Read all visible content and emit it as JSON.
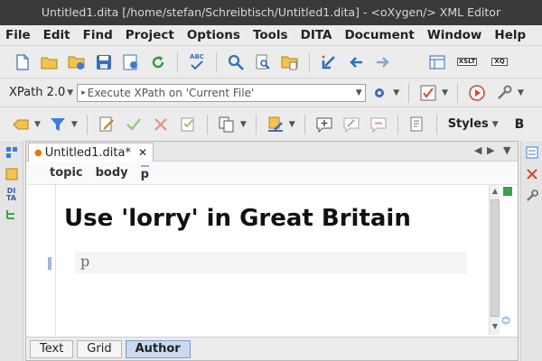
{
  "window": {
    "title": "Untitled1.dita [/home/stefan/Schreibtisch/Untitled1.dita] - <oXygen/> XML Editor"
  },
  "menu": [
    {
      "label": "File"
    },
    {
      "label": "Edit"
    },
    {
      "label": "Find"
    },
    {
      "label": "Project"
    },
    {
      "label": "Options"
    },
    {
      "label": "Tools"
    },
    {
      "label": "DITA"
    },
    {
      "label": "Document"
    },
    {
      "label": "Window"
    },
    {
      "label": "Help"
    }
  ],
  "toolbar1": {
    "icons": [
      "new-file-icon",
      "open-folder-icon",
      "open-url-icon",
      "save-icon",
      "save-all-icon",
      "reload-icon",
      "spellcheck-icon",
      "search-icon",
      "find-in-files-icon",
      "folder-search-icon",
      "back-icon",
      "previous-icon",
      "next-icon",
      "perspective-editor-icon",
      "xslt-icon",
      "xquery-icon"
    ],
    "spellcheck_text": "ABC",
    "xslt_text": "XSLT",
    "xquery_text": "XQ"
  },
  "toolbar2": {
    "xpath_label": "XPath 2.0",
    "xpath_placeholder": "Execute XPath on  'Current File'"
  },
  "toolbar3": {
    "styles_label": "Styles",
    "bold_label": "B"
  },
  "editor": {
    "tab_label": "Untitled1.dita*",
    "breadcrumb": [
      "topic",
      "body",
      "p"
    ],
    "title_text": "Use 'lorry' in Great Britain",
    "paragraph_tag": "p"
  },
  "left_strip": {
    "dita_label_1": "DI",
    "dita_label_2": "TA"
  },
  "bottom_tabs": [
    {
      "label": "Text",
      "active": false
    },
    {
      "label": "Grid",
      "active": false
    },
    {
      "label": "Author",
      "active": true
    }
  ]
}
